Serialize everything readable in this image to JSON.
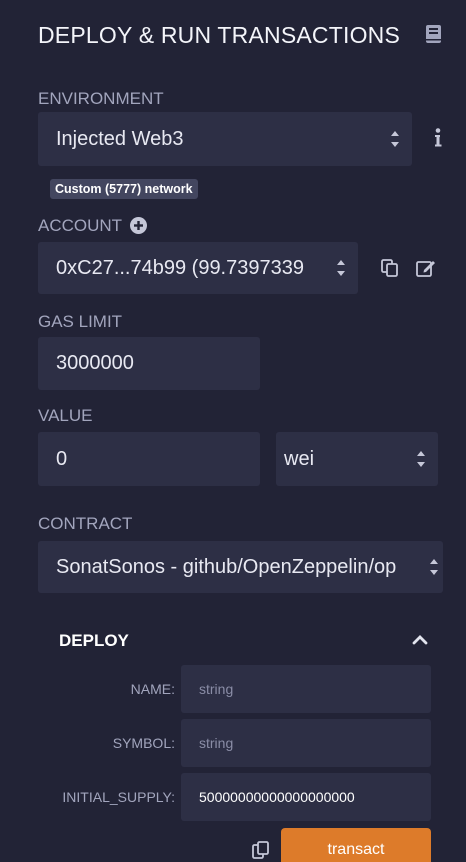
{
  "header": {
    "title": "DEPLOY & RUN TRANSACTIONS",
    "icon": "book-icon"
  },
  "environment": {
    "label": "ENVIRONMENT",
    "selected": "Injected Web3",
    "network_badge": "Custom (5777) network"
  },
  "account": {
    "label": "ACCOUNT",
    "selected": "0xC27...74b99 (99.7397339"
  },
  "gas_limit": {
    "label": "GAS LIMIT",
    "value": "3000000"
  },
  "value": {
    "label": "VALUE",
    "amount": "0",
    "unit": "wei"
  },
  "contract": {
    "label": "CONTRACT",
    "selected": "SonatSonos - github/OpenZeppelin/op"
  },
  "deploy": {
    "title": "DEPLOY",
    "params": [
      {
        "label": "NAME:",
        "placeholder": "string",
        "value": ""
      },
      {
        "label": "SYMBOL:",
        "placeholder": "string",
        "value": ""
      },
      {
        "label": "INITIAL_SUPPLY:",
        "placeholder": "",
        "value": "50000000000000000000"
      }
    ],
    "transact_label": "transact"
  },
  "colors": {
    "background": "#222336",
    "field": "#2d2f45",
    "accent": "#dd7b2a"
  }
}
